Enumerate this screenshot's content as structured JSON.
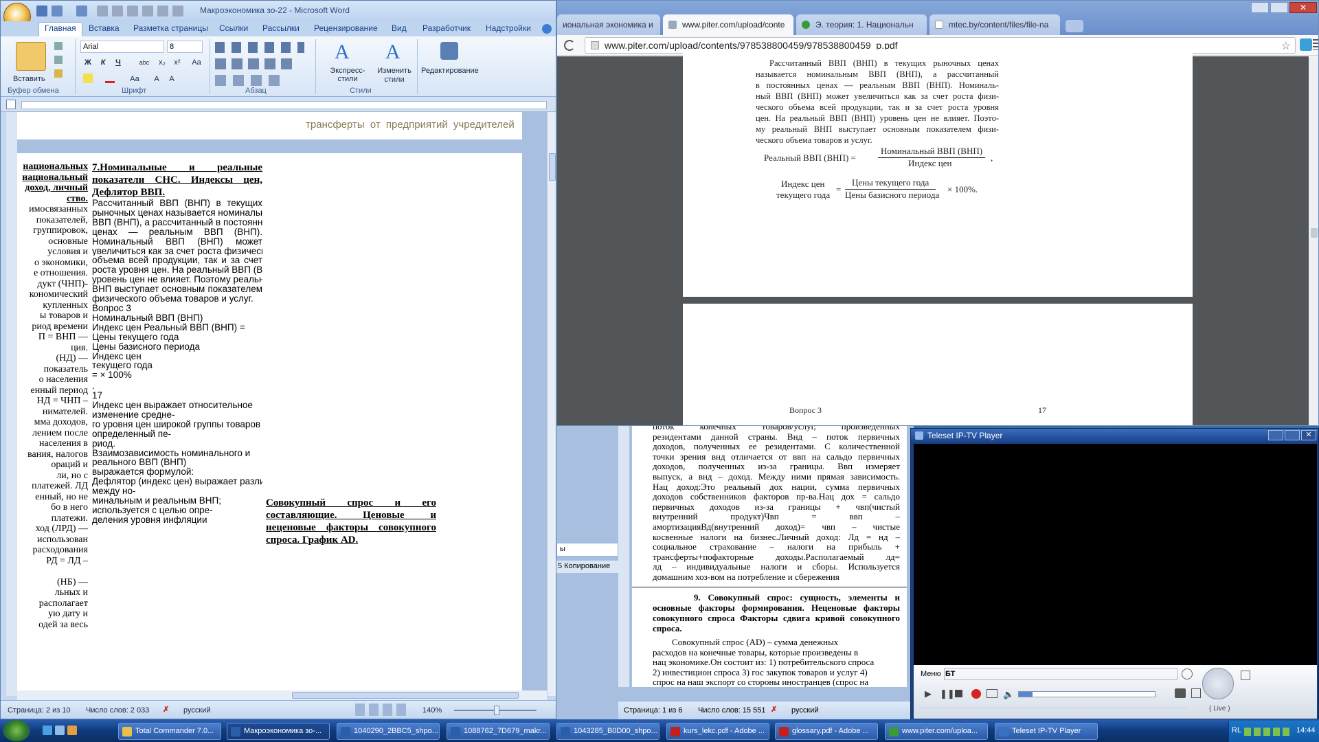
{
  "word": {
    "title": "Макроэкономика зо-22 - Microsoft Word",
    "tabs": [
      "Главная",
      "Вставка",
      "Разметка страницы",
      "Ссылки",
      "Рассылки",
      "Рецензирование",
      "Вид",
      "Разработчик",
      "Надстройки"
    ],
    "font_name": "Arial",
    "font_size": "8",
    "paste_label": "Вставить",
    "groups": {
      "clipboard": "Буфер обмена",
      "font": "Шрифт",
      "paragraph": "Абзац",
      "styles": "Стили"
    },
    "express_styles": "Экспресс-стили",
    "change_styles": "Изменить стили",
    "editing": "Редактирование",
    "page1_line": "трансферты от предприятий учредителей",
    "left_col": [
      "национальных",
      "национальный",
      "доход, личный",
      "ство.",
      "имосвязанных",
      "показателей,",
      "группировок,",
      "основные",
      "условия и",
      "о экономики,",
      "е отношения.",
      "дукт (ЧНП)-",
      "кономический",
      "купленных",
      "ы товаров и",
      "риод времени",
      "П = ВНП —",
      "ция.",
      "(НД) —",
      "показатель",
      "о населения",
      "енный период",
      "НД = ЧНП –",
      "нимателей.",
      "мма доходов,",
      "лением после",
      "населения в",
      "вания, налогов",
      "ораций и",
      "ли, но с",
      "платежей. ЛД",
      "енный, но не",
      "бо в него",
      "платежи.",
      "ход (ЛРД) —",
      "использован",
      "расходования",
      "РД = ЛД –",
      "",
      "(НБ) —",
      "льных и",
      "располагает",
      "ую дату и",
      "одей за весь"
    ],
    "heading": "7.Номинальные и реальные показатели СНС. Индексы цен, Дефлятор ВВП.",
    "para1": [
      "Рассчитанный ВВП (ВНП) в текущих",
      "рыночных ценах называется номинальным",
      "ВВП (ВНП), а рассчитанный в постоянных",
      "ценах — реальным ВВП (ВНП).",
      "Номинальный ВВП (ВНП) может",
      "увеличиться как за счет роста физического",
      "объема всей продукции, так и за счет",
      "роста уровня цен. На реальный ВВП (ВНП)",
      "уровень цен не влияет. Поэтому реальный",
      "ВНП выступает основным показателем",
      "физического объема товаров и услуг."
    ],
    "para2": [
      "Вопрос 3",
      "Номинальный ВВП (ВНП)",
      "Индекс цен Реальный ВВП (ВНП) =",
      "Цены текущего года",
      "Цены базисного периода",
      "Индекс цен",
      "текущего года",
      "= × 100%",
      ".",
      "17",
      "Индекс цен выражает относительное",
      "изменение средне‑",
      "го уровня цен широкой группы товаров за",
      "определенный пе‑",
      "риод.",
      "Взаимозависимость номинального и",
      "реального ВВП (ВНП)",
      "выражается формулой:",
      "Дефлятор (индекс цен) выражает различия",
      "между но‑",
      "минальным и реальным ВНП;",
      "используется с целью опре‑",
      "деления уровня инфляции"
    ],
    "right_heading": "Совокупный спрос и его составляющие. Ценовые и неценовые факторы совокупного спроса. График AD.",
    "status": {
      "page": "Страница: 2 из 10",
      "words": "Число слов: 2 033",
      "lang": "русский",
      "zoom": "140%"
    }
  },
  "chrome": {
    "tabs": [
      {
        "label": "иональная экономика и",
        "active": false
      },
      {
        "label": "www.piter.com/upload/conte",
        "active": true
      },
      {
        "label": "Э. теория: 1. Национальн",
        "active": false
      },
      {
        "label": "mtec.by/content/files/file-na",
        "active": false
      }
    ],
    "url": "www.piter.com/upload/contents/978538800459/978538800459_p.pdf",
    "pdf_text": [
      "Рассчитанный ВВП (ВНП) в текущих рыночных ценах",
      "называется номинальным ВВП (ВНП), а рассчитанный",
      "в постоянных ценах — реальным ВВП (ВНП). Номиналь-",
      "ный ВВП (ВНП) может увеличиться как за счет роста физи-",
      "ческого объема всей продукции, так и за счет роста уровня",
      "цен. На реальный ВВП (ВНП) уровень цен не влияет. Поэто-",
      "му реальный ВНП выступает основным показателем физи-",
      "ческого объема товаров и услуг."
    ],
    "formula1": {
      "lhs": "Реальный ВВП (ВНП) =",
      "num": "Номинальный ВВП (ВНП)",
      "den": "Индекс цен"
    },
    "formula2": {
      "lhs1": "Индекс цен",
      "lhs2": "текущего года",
      "num": "Цены текущего года",
      "den": "Цены базисного периода",
      "tail": "× 100%."
    },
    "footer_left": "Вопрос 3",
    "footer_right": "17"
  },
  "word2": {
    "lines": [
      "поток конечных товаров/услуг, произведенных",
      "резидентами данной страны. Внд – поток первичных",
      "доходов, полученных ее резидентами. С количественной",
      "точки зрения внд отличается от ввп на сальдо первичных",
      "доходов, полученных из-за границы. Ввп измеряет",
      "выпуск, а внд – доход. Между ними прямая зависимость.",
      "Нац доход:Это реальный дох нации, сумма первичных",
      "доходов собственников факторов пр-ва.Нац дох = сальдо",
      "первичных доходов из-за границы + чвп(чистый",
      "внутренний продукт)Чвп = ввп –",
      "амортизацияВд(внутренний доход)= чвп – чистые",
      "косвенные налоги на бизнес.Личный доход: Лд = нд –",
      "социальное страхование – налоги на прибыль +",
      "трансферты+пофакторные доходы.Располагаемый лд=",
      "лд – индивидуальные налоги и сборы. Используется",
      "домашним хоз-вом на потребление и сбережения"
    ],
    "heading9": "9. Совокупный спрос: сущность, элементы и основные факторы формирования. Неценовые факторы совокупного спроса Факторы сдвига кривой совокупного спроса.",
    "para9": [
      "Совокупный спрос (AD) – сумма денежных",
      "расходов на конечные товары, которые произведены в",
      "нац экономике.Он состоит из: 1) потребительского спроса",
      "2) инвестицион спроса 3) гос закупок товаров и услуг 4)",
      "спрос на наш экспорт со стороны иностранцев (спрос на"
    ],
    "side_labels": [
      "ы",
      "5 Копирование"
    ],
    "status": {
      "page": "Страница: 1 из 6",
      "words": "Число слов: 15 551",
      "lang": "русский"
    }
  },
  "iptv": {
    "title": "Teleset IP-TV Player",
    "menu": "Меню",
    "channel": "БТ",
    "live": "( Live )"
  },
  "taskbar": {
    "items": [
      {
        "label": "Total Commander 7.0...",
        "color": "#e8c04a"
      },
      {
        "label": "Макроэкономика зо-...",
        "color": "#2b5ea8"
      },
      {
        "label": "1040290_2BBC5_shpo...",
        "color": "#2b5ea8"
      },
      {
        "label": "1088762_7D679_makr...",
        "color": "#2b5ea8"
      },
      {
        "label": "1043285_B0D00_shpo...",
        "color": "#2b5ea8"
      },
      {
        "label": "kurs_lekc.pdf - Adobe ...",
        "color": "#c21f1f"
      },
      {
        "label": "glossary.pdf - Adobe ...",
        "color": "#c21f1f"
      },
      {
        "label": "www.piter.com/uploa...",
        "color": "#3a9a3a"
      },
      {
        "label": "Teleset IP-TV Player",
        "color": "#3a6fc2"
      }
    ],
    "lang": "RL",
    "clock": "14:44"
  }
}
